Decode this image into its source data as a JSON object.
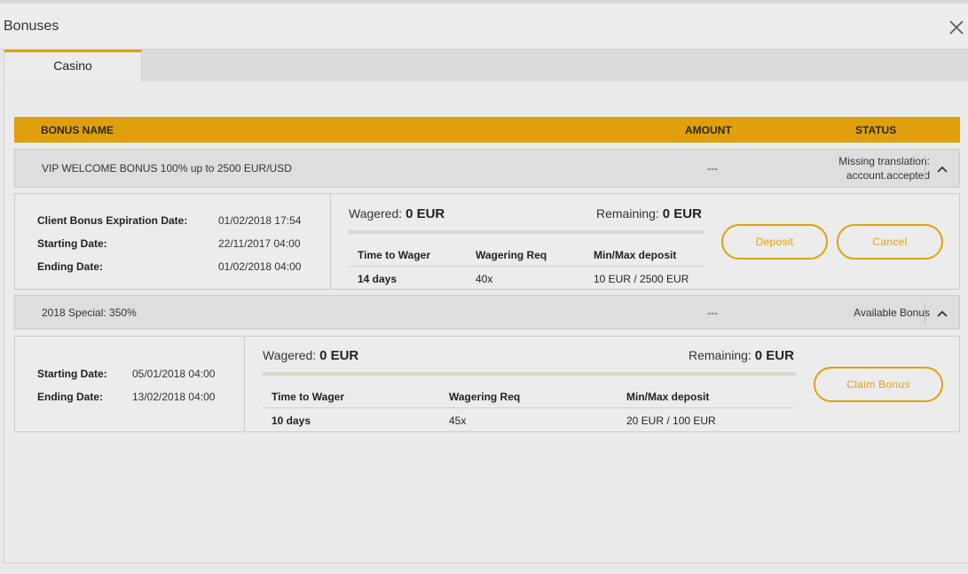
{
  "window": {
    "title": "Bonuses",
    "close_icon": "close-icon"
  },
  "tabs": [
    {
      "label": "Casino",
      "active": true
    }
  ],
  "table": {
    "headers": {
      "name": "BONUS NAME",
      "amount": "AMOUNT",
      "status": "STATUS"
    }
  },
  "bonuses": [
    {
      "name": "VIP WELCOME BONUS 100% up to 2500 EUR/USD",
      "amount": "---",
      "status_line1": "Missing translation:",
      "status_line2": "account.accepted",
      "expanded": true,
      "dates": [
        {
          "label": "Client Bonus Expiration Date:",
          "value": "01/02/2018 17:54"
        },
        {
          "label": "Starting Date:",
          "value": "22/11/2017 04:00"
        },
        {
          "label": "Ending Date:",
          "value": "01/02/2018 04:00"
        }
      ],
      "wagered_label": "Wagered:",
      "wagered_value": "0 EUR",
      "remaining_label": "Remaining:",
      "remaining_value": "0 EUR",
      "progress_fraction": 0,
      "columns": [
        "Time to Wager",
        "Wagering Req",
        "Min/Max deposit"
      ],
      "values": [
        "14 days",
        "40x",
        "10 EUR / 2500 EUR"
      ],
      "buttons": {
        "deposit": "Deposit",
        "cancel": "Cancel"
      }
    },
    {
      "name": "2018 Special: 350%",
      "amount": "---",
      "status": "Available Bonus",
      "expanded": true,
      "dates": [
        {
          "label": "Starting Date:",
          "value": "05/01/2018 04:00"
        },
        {
          "label": "Ending Date:",
          "value": "13/02/2018 04:00"
        }
      ],
      "wagered_label": "Wagered:",
      "wagered_value": "0 EUR",
      "remaining_label": "Remaining:",
      "remaining_value": "0 EUR",
      "progress_fraction": 0,
      "columns": [
        "Time to Wager",
        "Wagering Req",
        "Min/Max deposit"
      ],
      "values": [
        "10 days",
        "45x",
        "20 EUR / 100 EUR"
      ],
      "buttons": {
        "claim": "Claim Bonus"
      }
    }
  ],
  "colors": {
    "accent": "#e0a00d",
    "row_bg": "#dedede",
    "panel_bg": "#ececec"
  }
}
